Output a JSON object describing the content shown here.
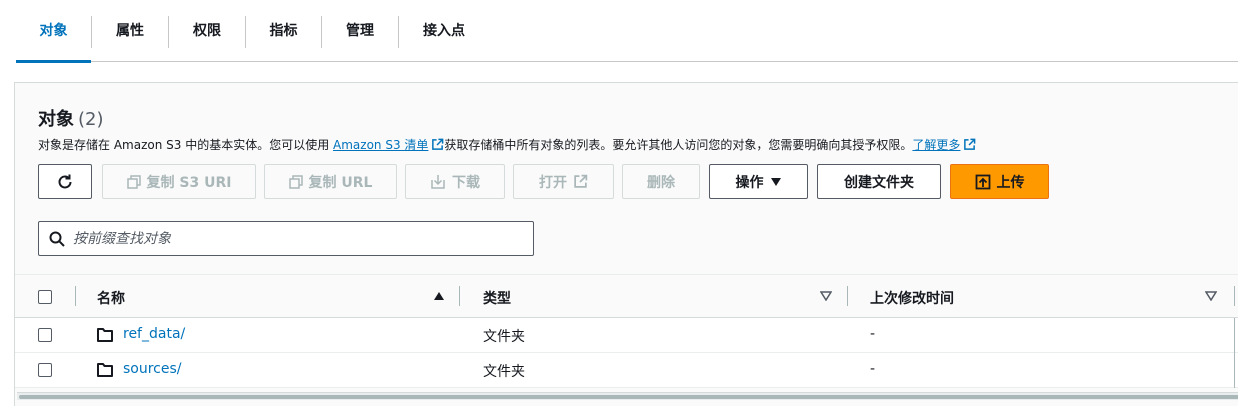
{
  "tabs": [
    {
      "label": "对象",
      "active": true
    },
    {
      "label": "属性",
      "active": false
    },
    {
      "label": "权限",
      "active": false
    },
    {
      "label": "指标",
      "active": false
    },
    {
      "label": "管理",
      "active": false
    },
    {
      "label": "接入点",
      "active": false
    }
  ],
  "panel": {
    "title": "对象",
    "count": "(2)",
    "desc_prefix": "对象是存储在 Amazon S3 中的基本实体。您可以使用 ",
    "desc_link": "Amazon S3 清单",
    "desc_middle": "获取存储桶中所有对象的列表。要允许其他人访问您的对象，您需要明确向其授予权限。",
    "learn_more": "了解更多"
  },
  "toolbar": {
    "copy_s3_uri": "复制 S3 URI",
    "copy_url": "复制 URL",
    "download": "下载",
    "open": "打开",
    "delete": "删除",
    "actions": "操作",
    "create_folder": "创建文件夹",
    "upload": "上传"
  },
  "search": {
    "placeholder": "按前缀查找对象",
    "value": ""
  },
  "table": {
    "columns": [
      "名称",
      "类型",
      "上次修改时间"
    ],
    "rows": [
      {
        "name": "ref_data/",
        "type": "文件夹",
        "modified": "-"
      },
      {
        "name": "sources/",
        "type": "文件夹",
        "modified": "-"
      }
    ]
  },
  "colors": {
    "accent": "#0073bb",
    "upload": "#ff9900",
    "border": "#d5dbdb"
  }
}
